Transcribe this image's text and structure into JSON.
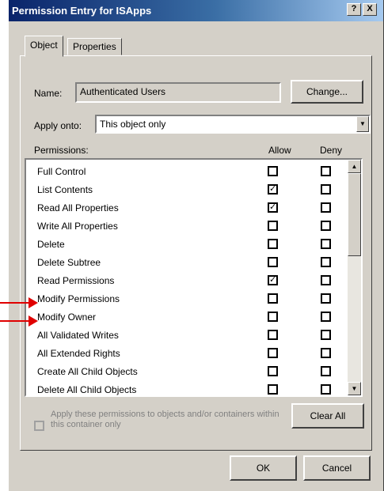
{
  "window": {
    "title": "Permission Entry for ISApps",
    "help_label": "?",
    "close_label": "X"
  },
  "tabs": [
    {
      "label": "Object",
      "active": true
    },
    {
      "label": "Properties",
      "active": false
    }
  ],
  "name_field": {
    "label": "Name:",
    "value": "Authenticated Users",
    "change_button": "Change..."
  },
  "apply_onto": {
    "label": "Apply onto:",
    "value": "This object only",
    "arrow_icon": "down-arrow"
  },
  "permissions": {
    "header": "Permissions:",
    "allow_header": "Allow",
    "deny_header": "Deny",
    "rows": [
      {
        "name": "Full Control",
        "allow": false,
        "deny": false
      },
      {
        "name": "List Contents",
        "allow": true,
        "deny": false
      },
      {
        "name": "Read All Properties",
        "allow": true,
        "deny": false
      },
      {
        "name": "Write All Properties",
        "allow": false,
        "deny": false
      },
      {
        "name": "Delete",
        "allow": false,
        "deny": false
      },
      {
        "name": "Delete Subtree",
        "allow": false,
        "deny": false
      },
      {
        "name": "Read Permissions",
        "allow": true,
        "deny": false
      },
      {
        "name": "Modify Permissions",
        "allow": false,
        "deny": false
      },
      {
        "name": "Modify Owner",
        "allow": false,
        "deny": false
      },
      {
        "name": "All Validated Writes",
        "allow": false,
        "deny": false
      },
      {
        "name": "All Extended Rights",
        "allow": false,
        "deny": false
      },
      {
        "name": "Create All Child Objects",
        "allow": false,
        "deny": false
      },
      {
        "name": "Delete All Child Objects",
        "allow": false,
        "deny": false
      }
    ]
  },
  "apply_checkbox": {
    "label": "Apply these permissions to objects and/or containers within this container only",
    "checked": false,
    "enabled": false
  },
  "buttons": {
    "clear_all": "Clear All",
    "ok": "OK",
    "cancel": "Cancel"
  },
  "annotations": {
    "color": "#e00000",
    "targets": [
      "Modify Permissions",
      "Modify Owner"
    ]
  }
}
